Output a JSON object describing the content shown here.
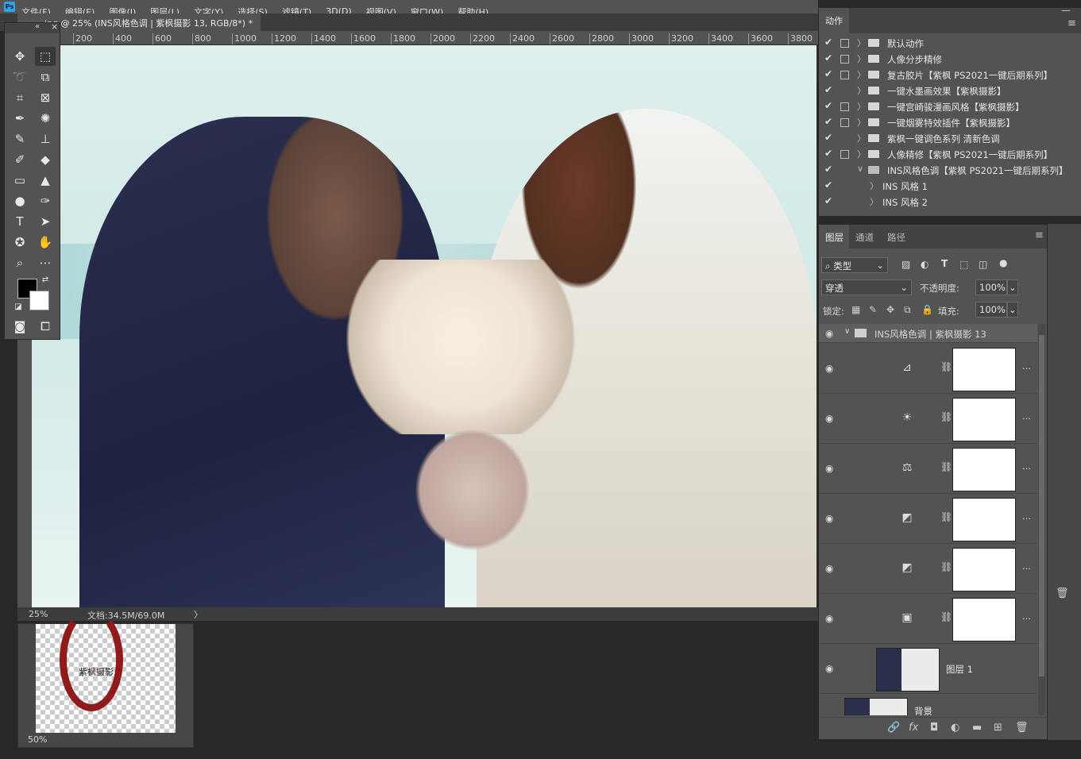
{
  "menubar": {
    "logo": "Ps",
    "items": [
      "文件(F)",
      "编辑(E)",
      "图像(I)",
      "图层(L)",
      "文字(Y)",
      "选择(S)",
      "滤镜(T)",
      "3D(D)",
      "视图(V)",
      "窗口(W)",
      "帮助(H)"
    ]
  },
  "document": {
    "tab_title": "....jpg @ 25% (INS风格色调 | 紫枫摄影  13, RGB/8*) *",
    "zoom": "25%",
    "doc_info": "文档:34.5M/69.0M",
    "nav_arrow": "〉"
  },
  "ruler": {
    "ticks": [
      "200",
      "400",
      "600",
      "800",
      "1000",
      "1200",
      "1400",
      "1600",
      "1800",
      "2000",
      "2200",
      "2400",
      "2600",
      "2800",
      "3000",
      "3200",
      "3400",
      "3600",
      "3800"
    ]
  },
  "second_doc": {
    "stamp_text": "紫枫摄影",
    "zoom": "50%"
  },
  "toolbar": {
    "collapse": "«",
    "close": "×"
  },
  "actions_panel": {
    "tab": "动作",
    "rows": [
      {
        "name": "默认动作",
        "dialog": true,
        "caret": "〉"
      },
      {
        "name": "人像分步精修",
        "dialog": true,
        "caret": "〉"
      },
      {
        "name": "复古胶片【紫枫 PS2021一键后期系列】",
        "dialog": true,
        "caret": "〉"
      },
      {
        "name": "一键水墨画效果【紫枫摄影】",
        "dialog": false,
        "caret": "〉"
      },
      {
        "name": "一键宫崎骏漫画风格【紫枫摄影】",
        "dialog": true,
        "caret": "〉"
      },
      {
        "name": "一键烟雾特效插件【紫枫摄影】",
        "dialog": true,
        "caret": "〉"
      },
      {
        "name": "紫枫一键调色系列 清新色调",
        "dialog": false,
        "caret": "〉"
      },
      {
        "name": "人像精修【紫枫 PS2021一键后期系列】",
        "dialog": true,
        "caret": "〉"
      },
      {
        "name": "INS风格色调【紫枫 PS2021一键后期系列】",
        "dialog": false,
        "caret": "∨"
      },
      {
        "name": "INS 风格  1",
        "dialog": false,
        "caret": "〉"
      },
      {
        "name": "INS 风格  2",
        "dialog": false,
        "caret": "〉"
      }
    ]
  },
  "layers_panel": {
    "tabs": [
      "图层",
      "通道",
      "路径"
    ],
    "filter_label": "类型",
    "blend_mode": "穿透",
    "opacity_label": "不透明度:",
    "opacity_value": "100%",
    "lock_label": "锁定:",
    "fill_label": "填充:",
    "fill_value": "100%",
    "group_name": "INS风格色调 | 紫枫摄影  13",
    "adjustments": [
      {
        "icon": "curves-icon",
        "glyph": "⊿"
      },
      {
        "icon": "brightness-icon",
        "glyph": "☀"
      },
      {
        "icon": "balance-icon",
        "glyph": "⚖"
      },
      {
        "icon": "hsl-icon",
        "glyph": "◩"
      },
      {
        "icon": "hsl-icon",
        "glyph": "◩"
      },
      {
        "icon": "gradient-map-icon",
        "glyph": "▣"
      }
    ],
    "layer1_name": "图层 1",
    "background_name": "背景",
    "bottom_icons": [
      "🔗",
      "fx",
      "◘",
      "◐",
      "▬",
      "⊞",
      "🗑"
    ]
  },
  "colors": {
    "panel": "#535353",
    "dark": "#282828",
    "accent": "#2fa3e6"
  }
}
